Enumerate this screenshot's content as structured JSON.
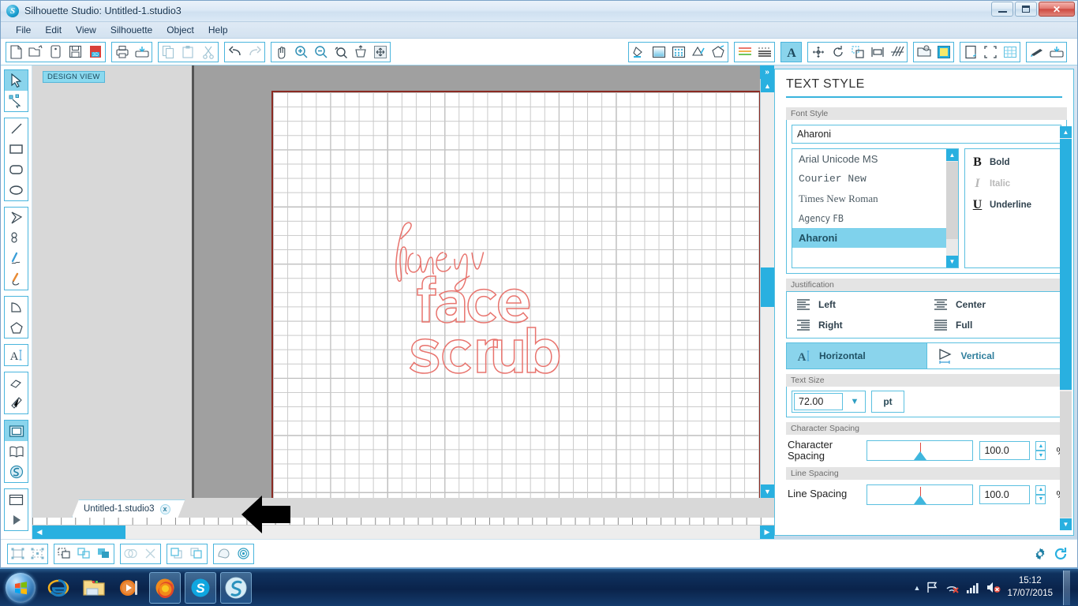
{
  "window": {
    "title": "Silhouette Studio: Untitled-1.studio3",
    "app_icon": "S",
    "minimize_label": "Minimize",
    "restore_label": "Restore",
    "close_label": "x"
  },
  "menu": {
    "items": [
      "File",
      "Edit",
      "View",
      "Silhouette",
      "Object",
      "Help"
    ]
  },
  "toolbar": {
    "groups": [
      {
        "name": "file",
        "buttons": [
          {
            "name": "new-document-icon",
            "label": "New"
          },
          {
            "name": "open-document-icon",
            "label": "Open"
          },
          {
            "name": "new-library-icon",
            "label": "New from Library"
          },
          {
            "name": "save-icon",
            "label": "Save"
          },
          {
            "name": "save-3d-icon",
            "label": "Save As 3D"
          }
        ]
      },
      {
        "name": "print",
        "buttons": [
          {
            "name": "print-icon",
            "label": "Print"
          },
          {
            "name": "send-to-silhouette-icon",
            "label": "Send to Silhouette"
          }
        ]
      },
      {
        "name": "clipboard",
        "buttons": [
          {
            "name": "copy-icon",
            "label": "Copy"
          },
          {
            "name": "paste-icon",
            "label": "Paste"
          },
          {
            "name": "cut-icon",
            "label": "Cut"
          }
        ]
      },
      {
        "name": "history",
        "buttons": [
          {
            "name": "undo-icon",
            "label": "Undo"
          },
          {
            "name": "redo-icon",
            "label": "Redo"
          }
        ]
      },
      {
        "name": "view",
        "buttons": [
          {
            "name": "pan-hand-icon",
            "label": "Pan"
          },
          {
            "name": "zoom-in-icon",
            "label": "Zoom In"
          },
          {
            "name": "zoom-out-icon",
            "label": "Zoom Out"
          },
          {
            "name": "zoom-selection-icon",
            "label": "Zoom to Selection"
          },
          {
            "name": "fit-to-page-icon",
            "label": "Fit to Page"
          },
          {
            "name": "fit-to-window-icon",
            "label": "Fit to Window"
          }
        ]
      },
      {
        "name": "style-panels",
        "buttons": [
          {
            "name": "fill-color-icon",
            "label": "Fill Color"
          },
          {
            "name": "fill-gradient-icon",
            "label": "Gradient Fill"
          },
          {
            "name": "fill-pattern-icon",
            "label": "Pattern Fill"
          },
          {
            "name": "line-color-icon",
            "label": "Line Color"
          },
          {
            "name": "line-style-icon",
            "label": "Line Style"
          }
        ]
      },
      {
        "name": "trace-panels",
        "buttons": [
          {
            "name": "sketch-pens-icon",
            "label": "Sketch Pens"
          },
          {
            "name": "cut-settings-icon",
            "label": "Cut Settings"
          }
        ]
      },
      {
        "name": "text-panel",
        "buttons": [
          {
            "name": "text-style-icon",
            "label": "Text Style",
            "active": true
          }
        ]
      },
      {
        "name": "transform-panels",
        "buttons": [
          {
            "name": "move-icon",
            "label": "Move"
          },
          {
            "name": "rotate-icon",
            "label": "Rotate"
          },
          {
            "name": "scale-icon",
            "label": "Scale"
          },
          {
            "name": "align-icon",
            "label": "Align"
          },
          {
            "name": "shear-icon",
            "label": "Shear"
          }
        ]
      },
      {
        "name": "library-panels",
        "buttons": [
          {
            "name": "my-library-icon",
            "label": "My Library"
          },
          {
            "name": "store-icon",
            "label": "Silhouette Store"
          }
        ]
      },
      {
        "name": "page-panels",
        "buttons": [
          {
            "name": "page-setup-icon",
            "label": "Page Setup"
          },
          {
            "name": "registration-marks-icon",
            "label": "Registration Marks"
          },
          {
            "name": "grid-icon",
            "label": "Grid"
          }
        ]
      },
      {
        "name": "cut-panels",
        "buttons": [
          {
            "name": "cut-style-icon",
            "label": "Cut Style"
          },
          {
            "name": "send-to-cut-icon",
            "label": "Cut"
          }
        ]
      }
    ]
  },
  "left_tools": {
    "groups": [
      {
        "name": "select",
        "buttons": [
          {
            "name": "select-tool",
            "label": "Select",
            "active": true
          },
          {
            "name": "edit-points-tool",
            "label": "Edit Points"
          }
        ]
      },
      {
        "name": "shapes",
        "buttons": [
          {
            "name": "line-tool",
            "label": "Line"
          },
          {
            "name": "rectangle-tool",
            "label": "Rectangle"
          },
          {
            "name": "rounded-rectangle-tool",
            "label": "Rounded Rectangle"
          },
          {
            "name": "ellipse-tool",
            "label": "Ellipse"
          }
        ]
      },
      {
        "name": "draw",
        "buttons": [
          {
            "name": "polygon-tool",
            "label": "Polygon"
          },
          {
            "name": "curve-tool",
            "label": "Curve"
          },
          {
            "name": "freehand-tool",
            "label": "Freehand"
          },
          {
            "name": "smooth-freehand-tool",
            "label": "Smooth Freehand"
          }
        ]
      },
      {
        "name": "arcs",
        "buttons": [
          {
            "name": "arc-tool",
            "label": "Arc"
          },
          {
            "name": "regular-polygon-tool",
            "label": "Regular Polygon"
          }
        ]
      },
      {
        "name": "text",
        "buttons": [
          {
            "name": "text-tool",
            "label": "Text"
          }
        ]
      },
      {
        "name": "edit",
        "buttons": [
          {
            "name": "eraser-tool",
            "label": "Eraser"
          },
          {
            "name": "knife-tool",
            "label": "Knife"
          }
        ]
      },
      {
        "name": "workspace",
        "buttons": [
          {
            "name": "design-page-tool",
            "label": "Design Page",
            "active": true
          },
          {
            "name": "library-tool",
            "label": "Library"
          },
          {
            "name": "store-tool",
            "label": "Silhouette Online Store"
          }
        ]
      },
      {
        "name": "preview",
        "buttons": [
          {
            "name": "panel-toggle-tool",
            "label": "Show Panel"
          },
          {
            "name": "play-preview-tool",
            "label": "Preview"
          }
        ]
      }
    ]
  },
  "canvas": {
    "view_badge": "DESIGN VIEW",
    "expand_panel_label": "»",
    "artwork_text_lines": [
      "honey",
      "face",
      "scrub"
    ],
    "artwork_color": "#e8736d",
    "page_border_color": "#8a2a22",
    "scroll_left_label": "◀",
    "scroll_right_label": "▶",
    "scroll_up_label": "▲",
    "scroll_down_label": "▼"
  },
  "document_tab": {
    "name": "Untitled-1.studio3",
    "close_label": "x"
  },
  "text_style_panel": {
    "title": "TEXT STYLE",
    "font_style": {
      "section_label": "Font Style",
      "input_value": "Aharoni",
      "fonts": [
        {
          "label": "Arial Unicode MS",
          "selected": false
        },
        {
          "label": "Courier New",
          "selected": false
        },
        {
          "label": "Times New Roman",
          "selected": false
        },
        {
          "label": "Agency FB",
          "selected": false
        },
        {
          "label": "Aharoni",
          "selected": true
        }
      ],
      "styles": [
        {
          "glyph": "B",
          "label": "Bold",
          "disabled": false
        },
        {
          "glyph": "I",
          "label": "Italic",
          "disabled": true
        },
        {
          "glyph": "U",
          "label": "Underline",
          "disabled": false
        }
      ]
    },
    "justification": {
      "section_label": "Justification",
      "options": [
        "Left",
        "Center",
        "Right",
        "Full"
      ],
      "orientation": [
        {
          "label": "Horizontal",
          "active": true
        },
        {
          "label": "Vertical",
          "active": false
        }
      ]
    },
    "text_size": {
      "section_label": "Text Size",
      "value": "72.00",
      "unit": "pt",
      "dropdown_label": "▼"
    },
    "character_spacing": {
      "section_label": "Character Spacing",
      "row_label": "Character Spacing",
      "value": "100.0",
      "unit": "%"
    },
    "line_spacing": {
      "section_label": "Line Spacing",
      "row_label": "Line Spacing",
      "value": "100.0",
      "unit": "%"
    }
  },
  "bottom_toolbar": {
    "groups": [
      {
        "name": "group-ungroup",
        "buttons": [
          {
            "name": "group-icon",
            "label": "Group"
          },
          {
            "name": "ungroup-icon",
            "label": "Ungroup"
          }
        ]
      },
      {
        "name": "compound",
        "buttons": [
          {
            "name": "make-compound-path-icon",
            "label": "Make Compound Path"
          },
          {
            "name": "release-compound-path-icon",
            "label": "Release Compound Path"
          },
          {
            "name": "weld-icon",
            "label": "Weld"
          }
        ]
      },
      {
        "name": "modify",
        "buttons": [
          {
            "name": "intersect-icon",
            "label": "Intersect"
          },
          {
            "name": "subtract-icon",
            "label": "Subtract"
          }
        ]
      },
      {
        "name": "arrange",
        "buttons": [
          {
            "name": "bring-to-front-icon",
            "label": "Bring to Front"
          },
          {
            "name": "send-to-back-icon",
            "label": "Send to Back"
          }
        ]
      },
      {
        "name": "effects",
        "buttons": [
          {
            "name": "shadow-icon",
            "label": "Shadow"
          },
          {
            "name": "offset-icon",
            "label": "Offset"
          }
        ]
      }
    ],
    "right_buttons": [
      {
        "name": "settings-gear-icon",
        "label": "Preferences"
      },
      {
        "name": "sync-refresh-icon",
        "label": "Sync"
      }
    ]
  },
  "taskbar": {
    "start_label": "Start",
    "apps": [
      {
        "name": "internet-explorer-icon",
        "label": "Internet Explorer",
        "running": false
      },
      {
        "name": "file-explorer-icon",
        "label": "Windows Explorer",
        "running": false
      },
      {
        "name": "media-player-icon",
        "label": "Windows Media Player",
        "running": false
      },
      {
        "name": "firefox-icon",
        "label": "Mozilla Firefox",
        "running": true
      },
      {
        "name": "skype-icon",
        "label": "Skype",
        "running": true
      },
      {
        "name": "silhouette-studio-icon",
        "label": "Silhouette Studio",
        "running": true
      }
    ],
    "tray": [
      {
        "name": "show-hidden-icons-icon",
        "label": "Show hidden icons"
      },
      {
        "name": "action-center-flag-icon",
        "label": "Action Center"
      },
      {
        "name": "network-disconnected-icon",
        "label": "Network"
      },
      {
        "name": "signal-bars-icon",
        "label": "Signal"
      },
      {
        "name": "volume-muted-icon",
        "label": "Volume"
      }
    ],
    "clock": {
      "time": "15:12",
      "date": "17/07/2015"
    }
  },
  "colors": {
    "accent": "#29b0e0",
    "panel_border": "#5bc0e0",
    "artwork": "#e8736d",
    "highlight": "#8ad4ec"
  }
}
